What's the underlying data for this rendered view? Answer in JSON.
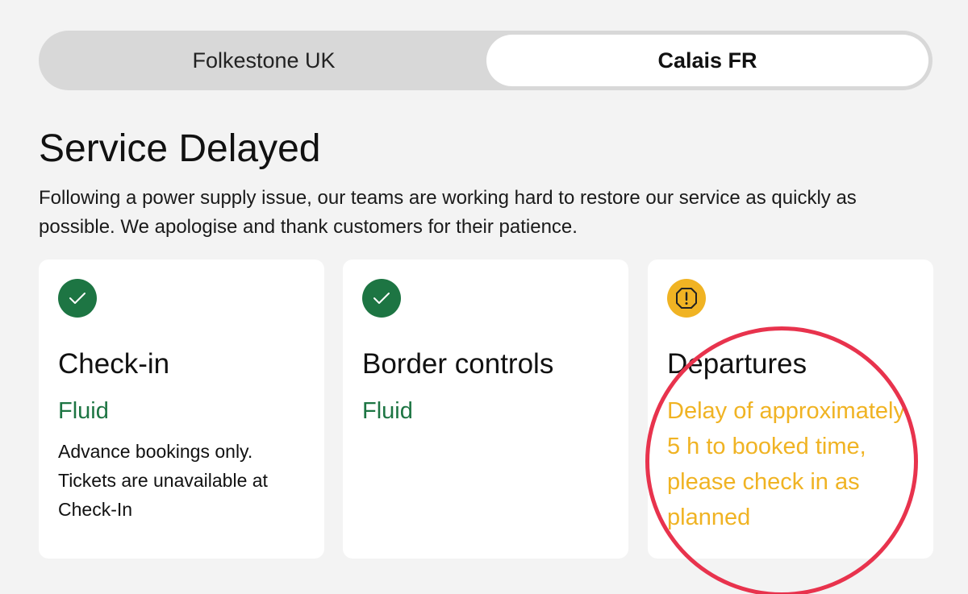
{
  "colors": {
    "ok": "#1d7543",
    "warning": "#f0b323",
    "annotation": "#e8334d"
  },
  "terminals": {
    "options": [
      "Folkestone UK",
      "Calais FR"
    ],
    "selected": "Calais FR"
  },
  "service": {
    "title": "Service Delayed",
    "message": "Following a power supply issue, our teams are working hard to restore our service as quickly as possible. We apologise and thank customers for their patience."
  },
  "cards": [
    {
      "icon": "check-circle-icon",
      "title": "Check-in",
      "status": "Fluid",
      "status_color": "#1d7543",
      "note": "Advance bookings only. Tickets are unavailable at Check-In"
    },
    {
      "icon": "check-circle-icon",
      "title": "Border controls",
      "status": "Fluid",
      "status_color": "#1d7543",
      "note": ""
    },
    {
      "icon": "warning-circle-icon",
      "title": "Departures",
      "status": "Delay of approximately 5 h to booked time, please check in as planned",
      "status_color": "#f0b323",
      "note": ""
    }
  ]
}
